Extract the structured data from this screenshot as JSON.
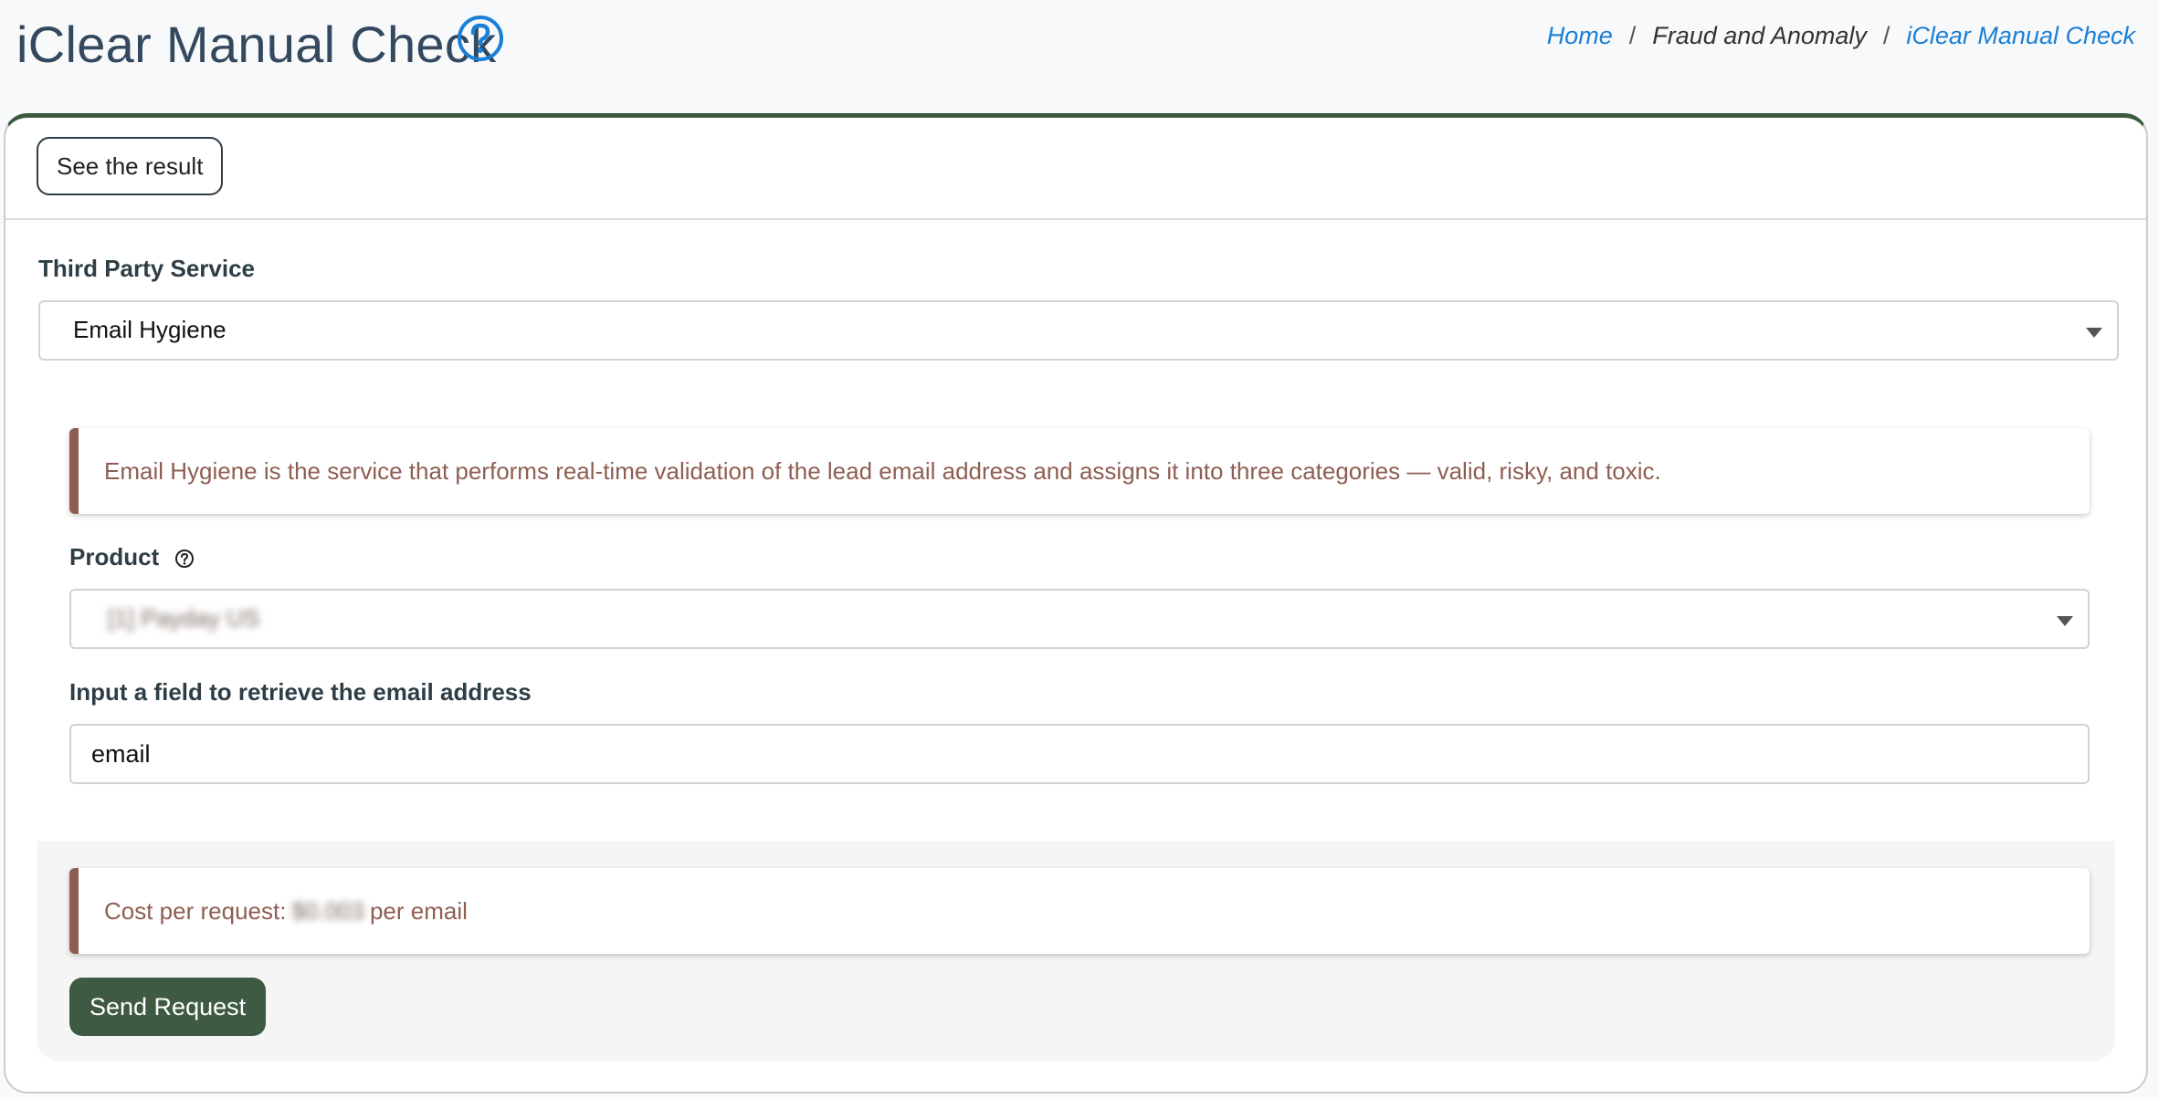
{
  "header": {
    "title": "iClear Manual Check",
    "breadcrumb": {
      "home": "Home",
      "section": "Fraud and Anomaly",
      "current": "iClear Manual Check",
      "separator": "/"
    }
  },
  "card": {
    "see_result_label": "See the result",
    "third_party_service": {
      "label": "Third Party Service",
      "selected": "Email Hygiene"
    },
    "description": "Email Hygiene is the service that performs real-time validation of the lead email address and assigns it into three categories — valid, risky, and toxic.",
    "product": {
      "label": "Product",
      "selected": "[1] Payday US"
    },
    "email_field": {
      "label": "Input a field to retrieve the email address",
      "value": "email"
    },
    "cost": {
      "prefix": "Cost per request:",
      "amount": "$0.003",
      "suffix": "per email"
    },
    "send_label": "Send Request"
  },
  "colors": {
    "accent": "#3a5a3e",
    "link": "#1a7fd6",
    "callout": "#8e5e52",
    "send_button": "#3f5a42"
  },
  "icons": {
    "title_help": "question-circle-icon",
    "product_help": "question-circle-icon",
    "dropdown": "caret-down-icon"
  }
}
